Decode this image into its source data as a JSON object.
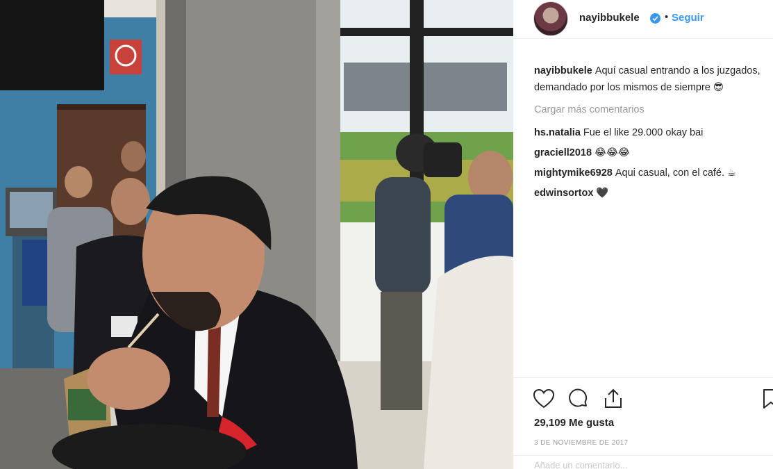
{
  "post": {
    "username": "nayibbukele",
    "follow_label": "Seguir",
    "separator": "•",
    "caption": "Aquí casual entrando a los juzgados, demandado por los mismos de siempre 😎",
    "load_more_label": "Cargar más comentarios",
    "comments": [
      {
        "user": "hs.natalia",
        "text": "Fue el like 29.000 okay bai"
      },
      {
        "user": "graciell2018",
        "text": "😂😂😂"
      },
      {
        "user": "mightymike6928",
        "text": "Aqui casual, con el café. ☕"
      },
      {
        "user": "edwinsortox",
        "text": "🖤"
      }
    ],
    "likes_text": "29,109 Me gusta",
    "date_text": "3 DE NOVIEMBRE DE 2017",
    "add_comment_placeholder": "Añade un comentario..."
  },
  "icons": {
    "like": "heart-icon",
    "comment": "comment-icon",
    "share": "share-icon",
    "save": "bookmark-icon",
    "verified": "verified-badge-icon"
  },
  "colors": {
    "link_blue": "#3897f0",
    "text": "#262626",
    "muted": "#999999",
    "divider": "#efefef"
  }
}
